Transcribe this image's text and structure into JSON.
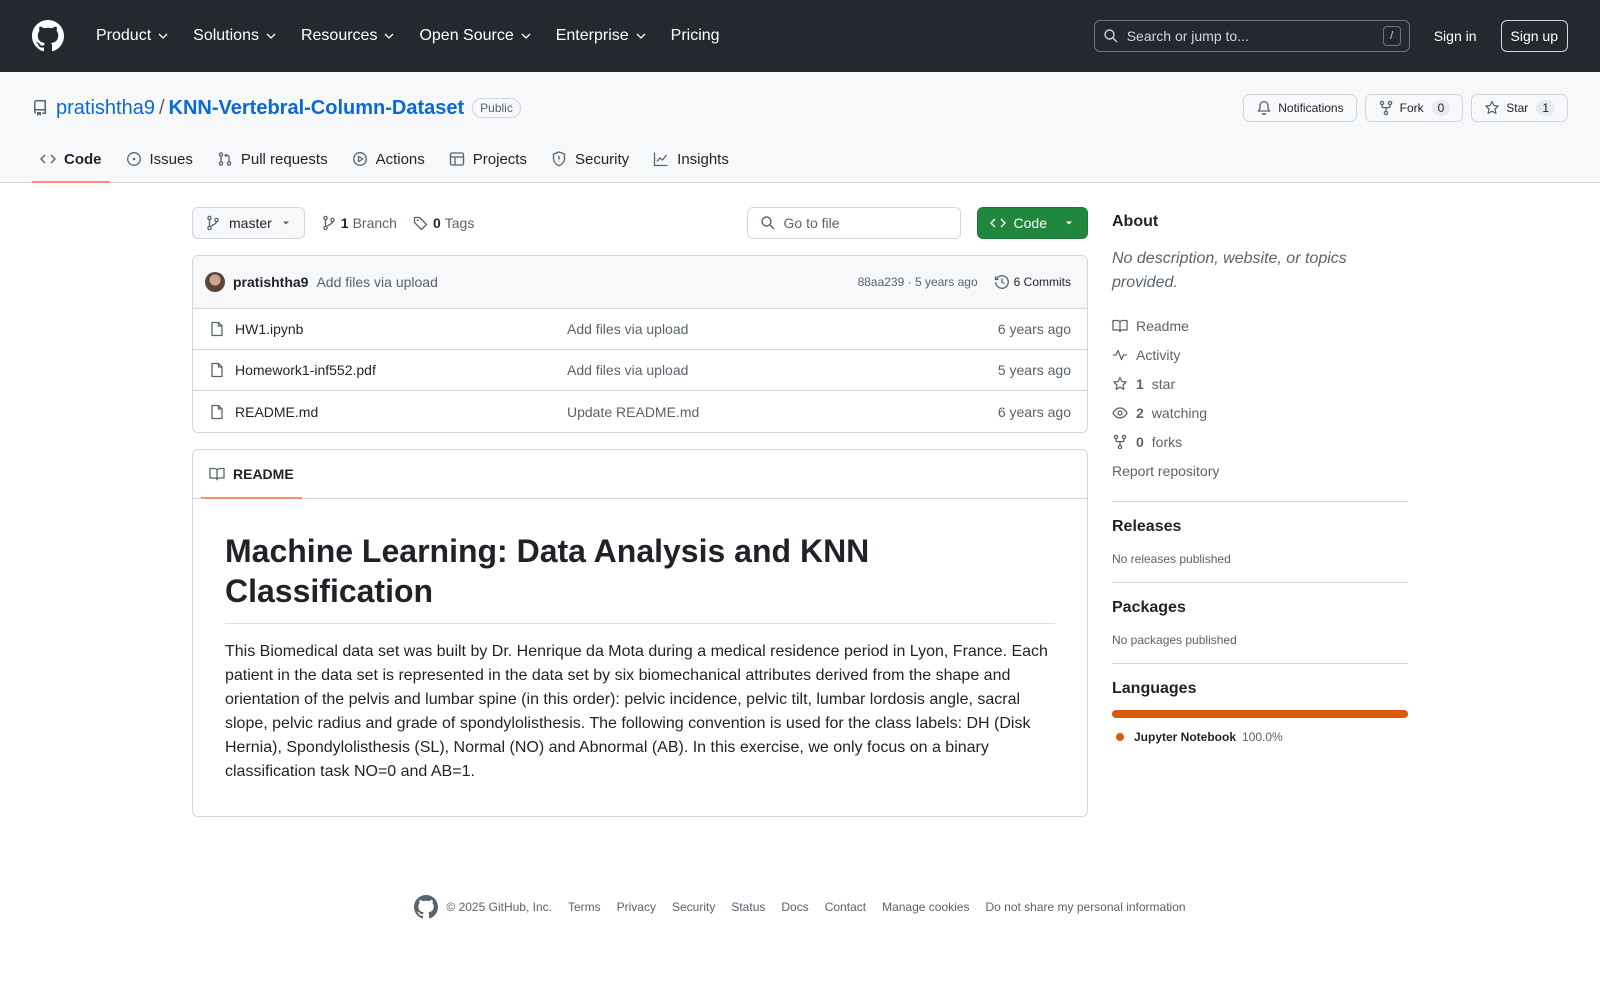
{
  "header": {
    "nav": [
      "Product",
      "Solutions",
      "Resources",
      "Open Source",
      "Enterprise",
      "Pricing"
    ],
    "search_placeholder": "Search or jump to...",
    "search_shortcut": "/",
    "signin": "Sign in",
    "signup": "Sign up"
  },
  "repo": {
    "owner": "pratishtha9",
    "separator": "/",
    "name": "KNN-Vertebral-Column-Dataset",
    "visibility": "Public",
    "notifications_label": "Notifications",
    "fork_label": "Fork",
    "fork_count": "0",
    "star_label": "Star",
    "star_count": "1"
  },
  "tabs": [
    "Code",
    "Issues",
    "Pull requests",
    "Actions",
    "Projects",
    "Security",
    "Insights"
  ],
  "file_nav": {
    "branch": "master",
    "branch_count": "1",
    "branch_label": "Branch",
    "tag_count": "0",
    "tag_label": "Tags",
    "goto_placeholder": "Go to file",
    "code_button": "Code"
  },
  "latest_commit": {
    "author": "pratishtha9",
    "message": "Add files via upload",
    "hash_age": "88aa239 · 5 years ago",
    "commits": "6 Commits"
  },
  "files": [
    {
      "name": "HW1.ipynb",
      "commit": "Add files via upload",
      "age": "6 years ago"
    },
    {
      "name": "Homework1-inf552.pdf",
      "commit": "Add files via upload",
      "age": "5 years ago"
    },
    {
      "name": "README.md",
      "commit": "Update README.md",
      "age": "6 years ago"
    }
  ],
  "readme": {
    "tab": "README",
    "title": "Machine Learning: Data Analysis and KNN Classification",
    "body": "This Biomedical data set was built by Dr. Henrique da Mota during a medical residence period in Lyon, France. Each patient in the data set is represented in the data set by six biomechanical attributes derived from the shape and orientation of the pelvis and lumbar spine (in this order): pelvic incidence, pelvic tilt, lumbar lordosis angle, sacral slope, pelvic radius and grade of spondylolisthesis. The following convention is used for the class labels: DH (Disk Hernia), Spondylolisthesis (SL), Normal (NO) and Abnormal (AB). In this exercise, we only focus on a binary classification task NO=0 and AB=1."
  },
  "about": {
    "title": "About",
    "description": "No description, website, or topics provided.",
    "readme": "Readme",
    "activity": "Activity",
    "stars_count": "1",
    "stars_label": "star",
    "watching_count": "2",
    "watching_label": "watching",
    "forks_count": "0",
    "forks_label": "forks",
    "report": "Report repository"
  },
  "releases": {
    "title": "Releases",
    "text": "No releases published"
  },
  "packages": {
    "title": "Packages",
    "text": "No packages published"
  },
  "languages": {
    "title": "Languages",
    "items": [
      {
        "name": "Jupyter Notebook",
        "percent": "100.0%",
        "color": "#da5b0b"
      }
    ]
  },
  "footer": {
    "copyright": "© 2025 GitHub, Inc.",
    "links": [
      "Terms",
      "Privacy",
      "Security",
      "Status",
      "Docs",
      "Contact",
      "Manage cookies",
      "Do not share my personal information"
    ]
  }
}
